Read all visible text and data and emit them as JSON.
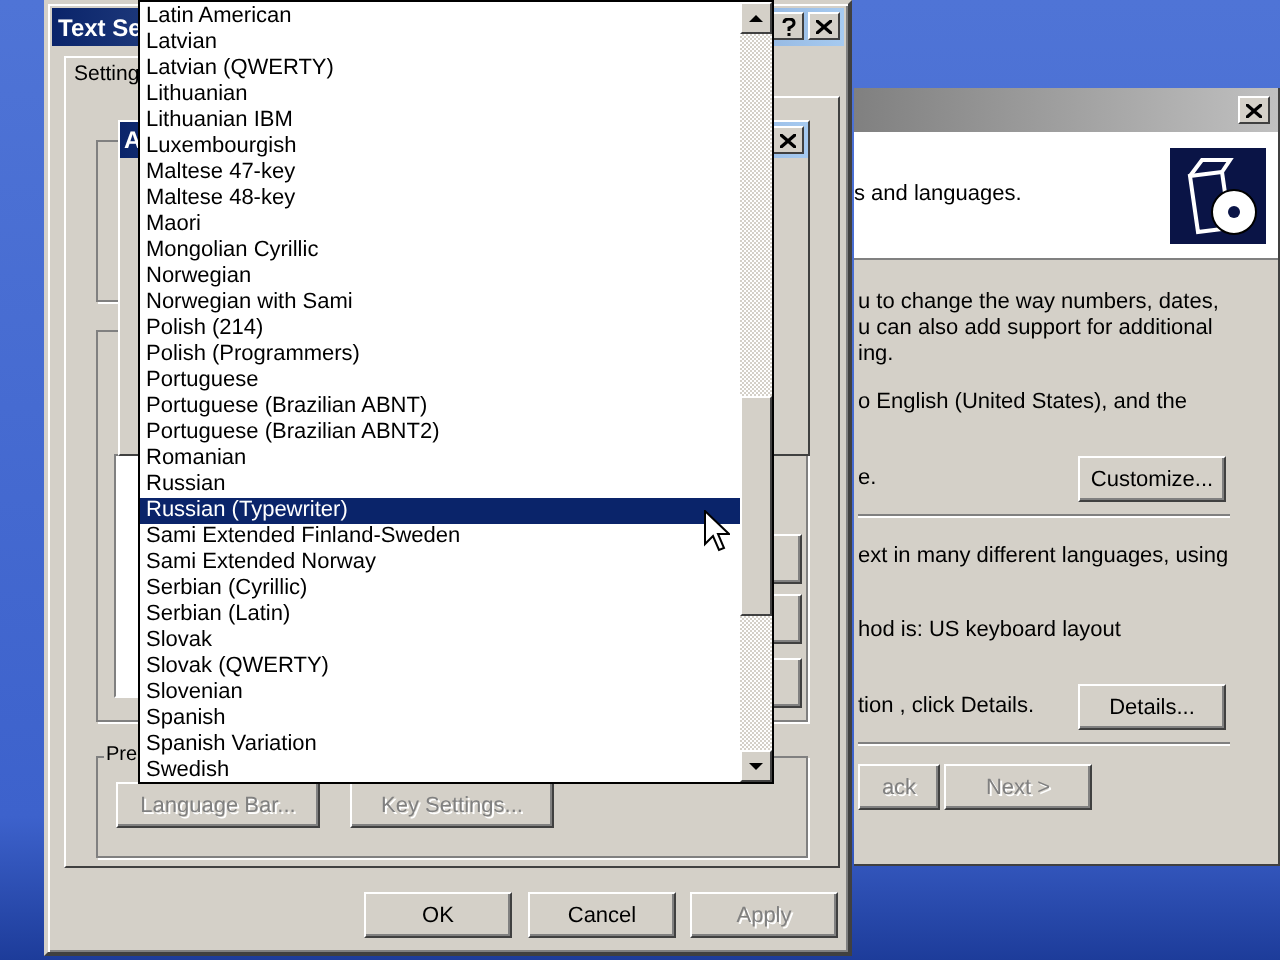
{
  "back_window": {
    "header": "s and languages.",
    "regional": {
      "lines": [
        "u to change the way numbers, dates,",
        "u can also add support for additional",
        "ing.",
        "o English (United States), and the"
      ],
      "last_line": "e.",
      "button": "Customize..."
    },
    "languages": {
      "lines": [
        "ext in many different languages, using",
        "hod is: US keyboard layout"
      ],
      "last_line": "tion , click Details.",
      "button": "Details..."
    },
    "nav_buttons": [
      {
        "label": "ack",
        "disabled": true
      },
      {
        "label": "Next >",
        "disabled": true
      }
    ]
  },
  "dialog": {
    "title": "Text Se",
    "tabs": [
      {
        "label": "Setting",
        "selected": true
      }
    ],
    "inner_dialog": {
      "title": "A"
    },
    "group_label": "Pre",
    "group_buttons": [
      {
        "label": "Language Bar...",
        "disabled": true
      },
      {
        "label": "Key Settings...",
        "disabled": true
      }
    ],
    "buttons": [
      {
        "label": "OK",
        "disabled": false
      },
      {
        "label": "Cancel",
        "disabled": false
      },
      {
        "label": "Apply",
        "disabled": true
      }
    ]
  },
  "dropdown_list": {
    "items": [
      {
        "label": "Latin American",
        "selected": false
      },
      {
        "label": "Latvian",
        "selected": false
      },
      {
        "label": "Latvian (QWERTY)",
        "selected": false
      },
      {
        "label": "Lithuanian",
        "selected": false
      },
      {
        "label": "Lithuanian IBM",
        "selected": false
      },
      {
        "label": "Luxembourgish",
        "selected": false
      },
      {
        "label": "Maltese 47-key",
        "selected": false
      },
      {
        "label": "Maltese 48-key",
        "selected": false
      },
      {
        "label": "Maori",
        "selected": false
      },
      {
        "label": "Mongolian Cyrillic",
        "selected": false
      },
      {
        "label": "Norwegian",
        "selected": false
      },
      {
        "label": "Norwegian with Sami",
        "selected": false
      },
      {
        "label": "Polish (214)",
        "selected": false
      },
      {
        "label": "Polish (Programmers)",
        "selected": false
      },
      {
        "label": "Portuguese",
        "selected": false
      },
      {
        "label": "Portuguese (Brazilian ABNT)",
        "selected": false
      },
      {
        "label": "Portuguese (Brazilian ABNT2)",
        "selected": false
      },
      {
        "label": "Romanian",
        "selected": false
      },
      {
        "label": "Russian",
        "selected": false
      },
      {
        "label": "Russian (Typewriter)",
        "selected": true
      },
      {
        "label": "Sami Extended Finland-Sweden",
        "selected": false
      },
      {
        "label": "Sami Extended Norway",
        "selected": false
      },
      {
        "label": "Serbian (Cyrillic)",
        "selected": false
      },
      {
        "label": "Serbian (Latin)",
        "selected": false
      },
      {
        "label": "Slovak",
        "selected": false
      },
      {
        "label": "Slovak (QWERTY)",
        "selected": false
      },
      {
        "label": "Slovenian",
        "selected": false
      },
      {
        "label": "Spanish",
        "selected": false
      },
      {
        "label": "Spanish Variation",
        "selected": false
      },
      {
        "label": "Swedish",
        "selected": false
      }
    ]
  }
}
